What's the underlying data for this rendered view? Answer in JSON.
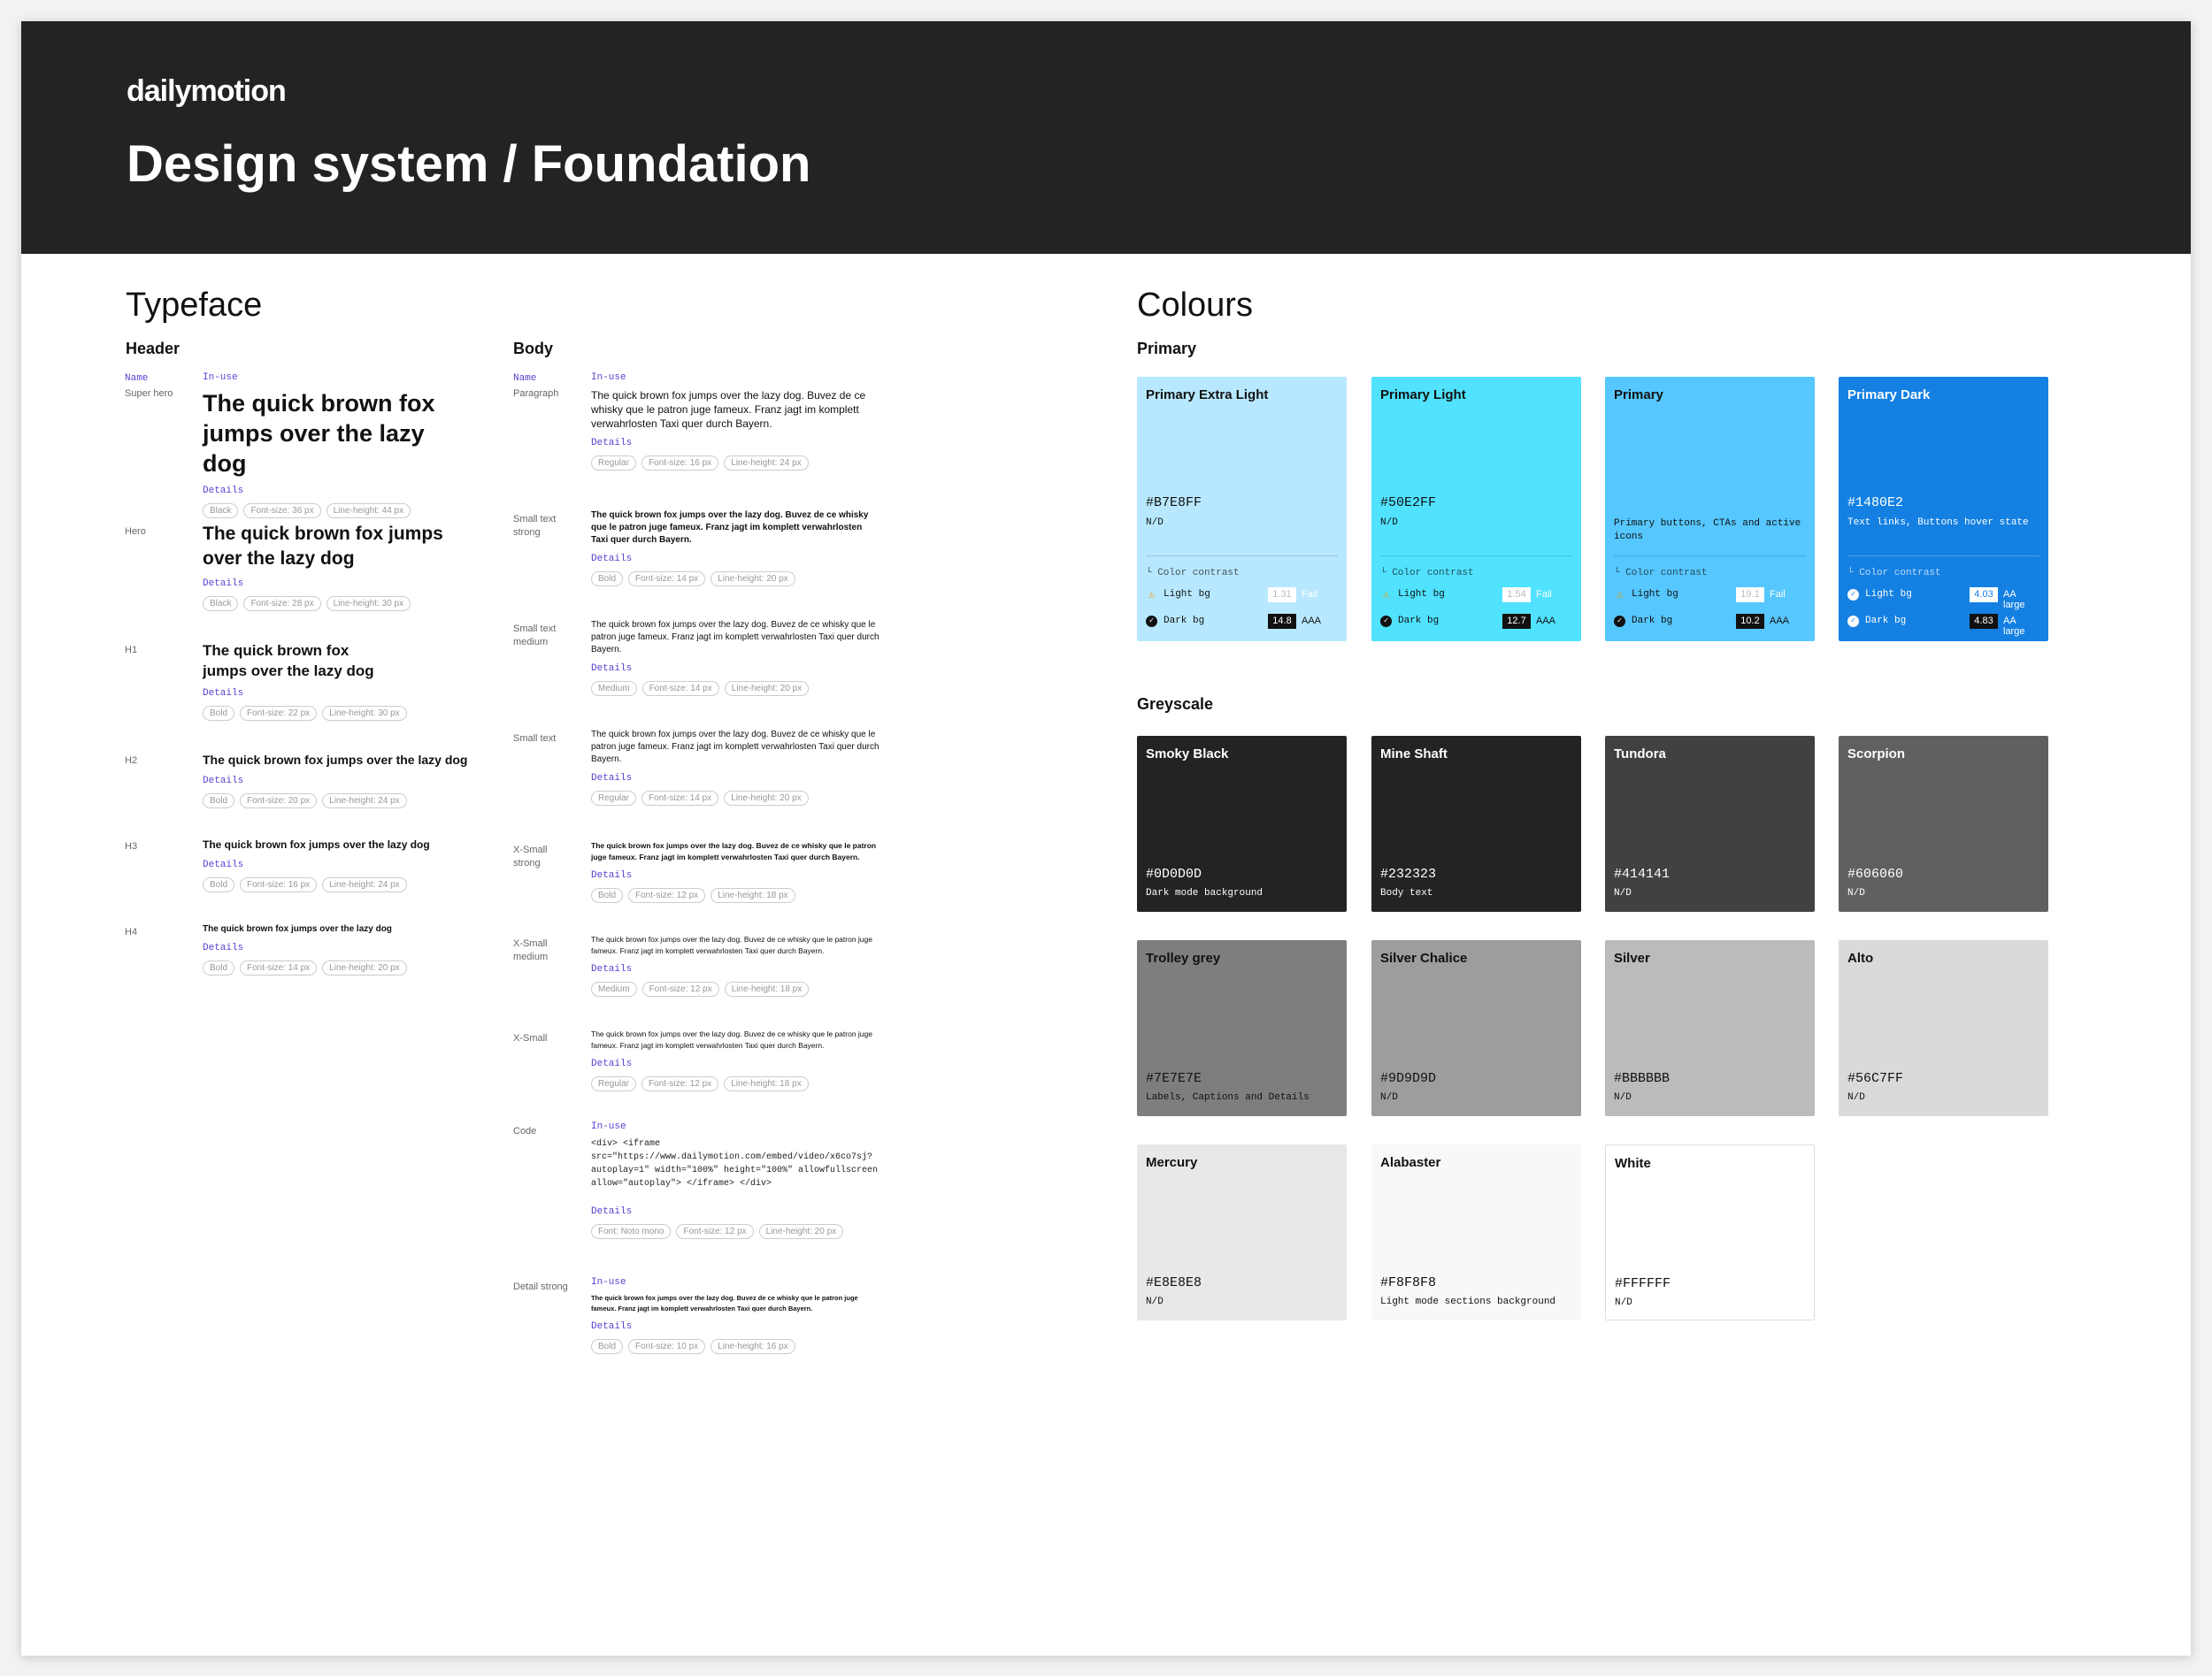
{
  "header": {
    "logo": "dailymotion",
    "title": "Design system / Foundation"
  },
  "typeface": {
    "title": "Typeface",
    "header_col": {
      "title": "Header",
      "name_label": "Name",
      "inuse_label": "In-use",
      "rows": [
        {
          "name": "Super hero",
          "sample": "The quick brown fox jumps over the lazy dog",
          "details": "Details",
          "chips": [
            "Black",
            "Font-size: 36 px",
            "Line-height: 44 px"
          ]
        },
        {
          "name": "Hero",
          "sample": "The quick brown fox jumps over the lazy dog",
          "details": "Details",
          "chips": [
            "Black",
            "Font-size: 28 px",
            "Line-height: 30 px"
          ]
        },
        {
          "name": "H1",
          "sample": "The quick brown fox jumps over the lazy dog",
          "details": "Details",
          "chips": [
            "Bold",
            "Font-size: 22 px",
            "Line-height: 30 px"
          ]
        },
        {
          "name": "H2",
          "sample": "The quick brown fox jumps over the lazy dog",
          "details": "Details",
          "chips": [
            "Bold",
            "Font-size: 20 px",
            "Line-height: 24 px"
          ]
        },
        {
          "name": "H3",
          "sample": "The quick brown fox jumps over the lazy dog",
          "details": "Details",
          "chips": [
            "Bold",
            "Font-size: 16 px",
            "Line-height: 24 px"
          ]
        },
        {
          "name": "H4",
          "sample": "The quick brown fox jumps over the lazy dog",
          "details": "Details",
          "chips": [
            "Bold",
            "Font-size: 14 px",
            "Line-height: 20 px"
          ]
        }
      ]
    },
    "body_col": {
      "title": "Body",
      "name_label": "Name",
      "inuse_label": "In-use",
      "rows": [
        {
          "name": "Paragraph",
          "sample": "The quick brown fox jumps over the lazy dog. Buvez de ce whisky que le patron juge fameux. Franz jagt im komplett verwahrlosten Taxi quer durch Bayern.",
          "details": "Details",
          "chips": [
            "Regular",
            "Font-size: 16 px",
            "Line-height: 24 px"
          ]
        },
        {
          "name": "Small text strong",
          "sample": "The quick brown fox jumps over the lazy dog. Buvez de ce whisky que le patron juge fameux. Franz jagt im komplett verwahrlosten Taxi quer durch Bayern.",
          "details": "Details",
          "chips": [
            "Bold",
            "Font-size: 14 px",
            "Line-height: 20 px"
          ]
        },
        {
          "name": "Small text medium",
          "sample": "The quick brown fox jumps over the lazy dog. Buvez de ce whisky que le patron juge fameux. Franz jagt im komplett verwahrlosten Taxi quer durch Bayern.",
          "details": "Details",
          "chips": [
            "Medium",
            "Font-size: 14 px",
            "Line-height: 20 px"
          ]
        },
        {
          "name": "Small text",
          "sample": "The quick brown fox jumps over the lazy dog. Buvez de ce whisky que le patron juge fameux. Franz jagt im komplett verwahrlosten Taxi quer durch Bayern.",
          "details": "Details",
          "chips": [
            "Regular",
            "Font-size: 14 px",
            "Line-height: 20 px"
          ]
        },
        {
          "name": "X-Small strong",
          "sample": "The quick brown fox jumps over the lazy dog. Buvez de ce whisky que le patron juge fameux. Franz jagt im komplett verwahrlosten Taxi quer durch Bayern.",
          "details": "Details",
          "chips": [
            "Bold",
            "Font-size: 12 px",
            "Line-height: 18 px"
          ]
        },
        {
          "name": "X-Small medium",
          "sample": "The quick brown fox jumps over the lazy dog. Buvez de ce whisky que le patron juge fameux. Franz jagt im komplett verwahrlosten Taxi quer durch Bayern.",
          "details": "Details",
          "chips": [
            "Medium",
            "Font-size: 12 px",
            "Line-height: 18 px"
          ]
        },
        {
          "name": "X-Small",
          "sample": "The quick brown fox jumps over the lazy dog. Buvez de ce whisky que le patron juge fameux. Franz jagt im komplett verwahrlosten Taxi quer durch Bayern.",
          "details": "Details",
          "chips": [
            "Regular",
            "Font-size: 12 px",
            "Line-height: 18 px"
          ]
        },
        {
          "name": "Code",
          "inuse": "In-use",
          "sample": "<div> <iframe src=\"https://www.dailymotion.com/embed/video/x6co7sj?autoplay=1\" width=\"100%\" height=\"100%\" allowfullscreen allow=\"autoplay\"> </iframe> </div>",
          "details": "Details",
          "chips": [
            "Font: Noto mono",
            "Font-size: 12 px",
            "Line-height: 20 px"
          ]
        },
        {
          "name": "Detail strong",
          "inuse": "In-use",
          "sample": "The quick brown fox jumps over the lazy dog. Buvez de ce whisky que le patron juge fameux. Franz jagt im komplett verwahrlosten Taxi quer durch Bayern.",
          "details": "Details",
          "chips": [
            "Bold",
            "Font-size: 10 px",
            "Line-height: 16 px"
          ]
        }
      ]
    }
  },
  "colours": {
    "title": "Colours",
    "primary_title": "Primary",
    "contrast_label": "└ Color contrast",
    "light_label": "Light bg",
    "dark_label": "Dark bg",
    "primary": [
      {
        "name": "Primary Extra Light",
        "hex": "#B7E8FF",
        "desc": "N/D",
        "light_ratio": "1.31",
        "light_result": "Fail",
        "dark_ratio": "14.8",
        "dark_result": "AAA"
      },
      {
        "name": "Primary Light",
        "hex": "#50E2FF",
        "desc": "N/D",
        "light_ratio": "1.54",
        "light_result": "Fail",
        "dark_ratio": "12.7",
        "dark_result": "AAA"
      },
      {
        "name": "Primary",
        "hex": "",
        "desc": "Primary buttons, CTAs and active icons",
        "light_ratio": "19.1",
        "light_result": "Fail",
        "dark_ratio": "10.2",
        "dark_result": "AAA"
      },
      {
        "name": "Primary Dark",
        "hex": "#1480E2",
        "desc": "Text links, Buttons hover state",
        "light_ratio": "4.03",
        "light_result": "AA large",
        "dark_ratio": "4.83",
        "dark_result": "AA large"
      }
    ],
    "greyscale_title": "Greyscale",
    "greyscale": [
      {
        "name": "Smoky Black",
        "hex": "#0D0D0D",
        "desc": "Dark mode background",
        "bg": "#232323",
        "fg": "#ffffff"
      },
      {
        "name": "Mine Shaft",
        "hex": "#232323",
        "desc": "Body text",
        "bg": "#232323",
        "fg": "#ffffff"
      },
      {
        "name": "Tundora",
        "hex": "#414141",
        "desc": "N/D",
        "bg": "#414141",
        "fg": "#ffffff"
      },
      {
        "name": "Scorpion",
        "hex": "#606060",
        "desc": "N/D",
        "bg": "#606060",
        "fg": "#ffffff"
      },
      {
        "name": "Trolley grey",
        "hex": "#7E7E7E",
        "desc": "Labels, Captions and Details",
        "bg": "#7e7e7e",
        "fg": "#111111"
      },
      {
        "name": "Silver Chalice",
        "hex": "#9D9D9D",
        "desc": "N/D",
        "bg": "#9d9d9d",
        "fg": "#111111"
      },
      {
        "name": "Silver",
        "hex": "#BBBBBB",
        "desc": "N/D",
        "bg": "#bbbbbb",
        "fg": "#111111"
      },
      {
        "name": "Alto",
        "hex": "#56C7FF",
        "desc": "N/D",
        "bg": "#dadada",
        "fg": "#111111"
      },
      {
        "name": "Mercury",
        "hex": "#E8E8E8",
        "desc": "N/D",
        "bg": "#e8e8e8",
        "fg": "#111111"
      },
      {
        "name": "Alabaster",
        "hex": "#F8F8F8",
        "desc": "Light mode sections background",
        "bg": "#f8f8f8",
        "fg": "#111111"
      },
      {
        "name": "White",
        "hex": "#FFFFFF",
        "desc": "N/D",
        "bg": "#ffffff",
        "fg": "#111111"
      }
    ]
  },
  "theme": {
    "primary_bgs": [
      "#b7e8ff",
      "#50e2ff",
      "#56c7ff",
      "#1480e2"
    ],
    "accent_purple": "#5b3fd0",
    "header_bg": "#232323"
  }
}
